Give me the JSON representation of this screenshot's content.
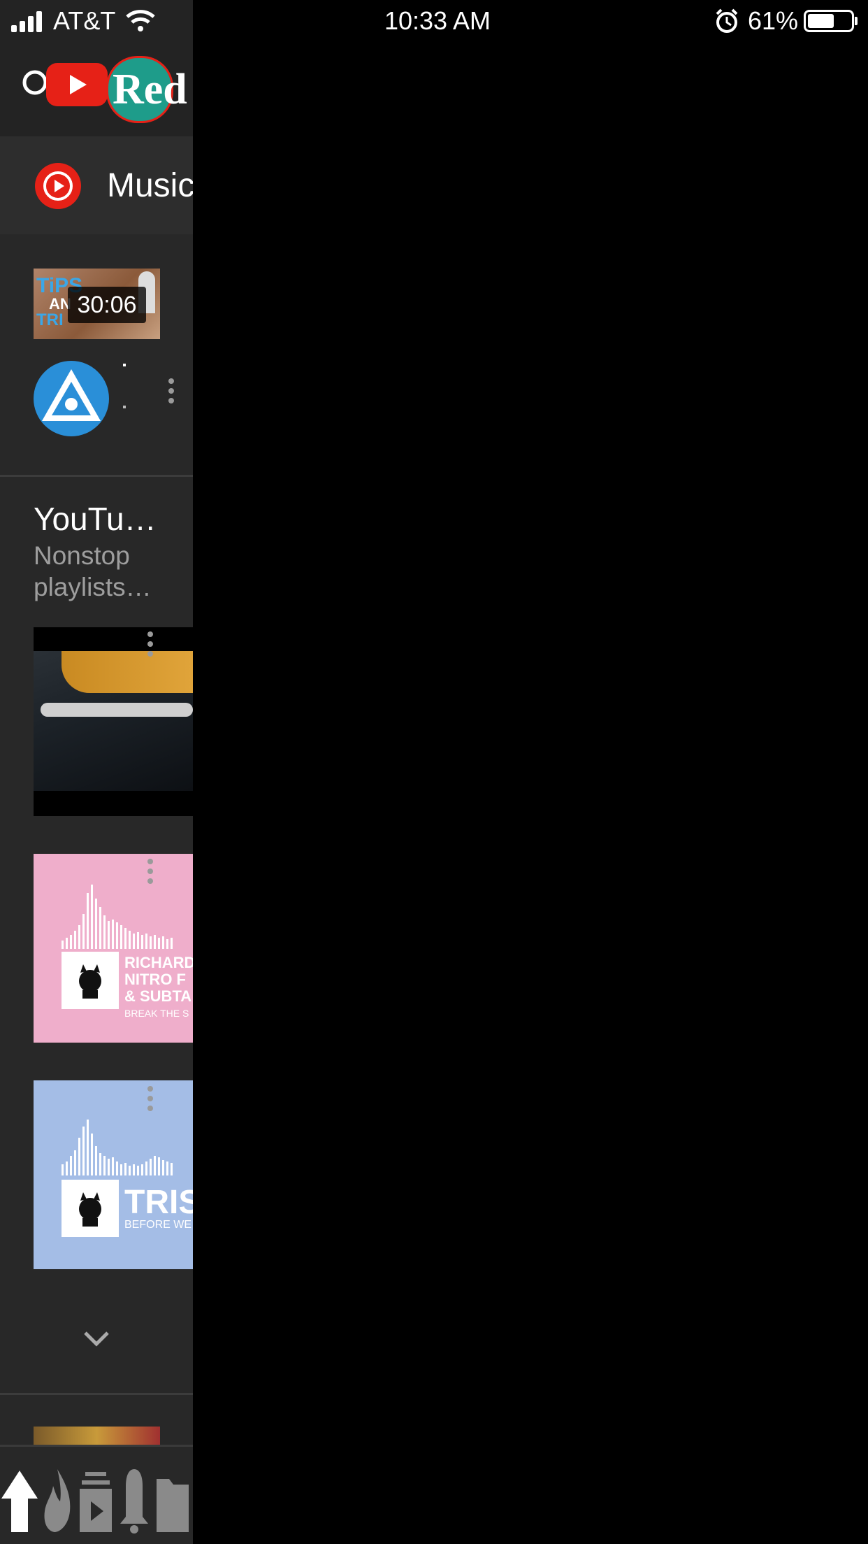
{
  "status_bar": {
    "carrier": "AT&T",
    "time": "10:33 AM",
    "battery_percent": "61%",
    "battery_level": 0.61
  },
  "header": {
    "logo_text": "Red"
  },
  "menu": {
    "music_label": "Music"
  },
  "video": {
    "thumb_text_1": "TiPS",
    "thumb_text_2": "AN",
    "thumb_text_3": "TRI",
    "duration": "30:06"
  },
  "shelf": {
    "title": "YouTu…",
    "subtitle_line1": "Nonstop",
    "subtitle_line2": "playlists…"
  },
  "tiles": {
    "tile2_line1": "RICHARD",
    "tile2_line2": "NITRO F",
    "tile2_line3": "& SUBTA",
    "tile2_line4": "BREAK THE S",
    "tile3_line1": "TRIS",
    "tile3_line2": "BEFORE WE"
  },
  "colors": {
    "panel_bg": "#282828",
    "brand_red": "#e62117",
    "pink_tile": "#efaecb",
    "blue_tile": "#a4bde6"
  },
  "icons": [
    "signal-icon",
    "wifi-icon",
    "alarm-icon",
    "battery-icon",
    "search-icon",
    "youtube-logo-icon",
    "music-play-icon",
    "more-vert-icon",
    "chevron-down-icon",
    "home-icon",
    "trending-icon",
    "subscriptions-icon",
    "notifications-icon",
    "library-icon"
  ]
}
